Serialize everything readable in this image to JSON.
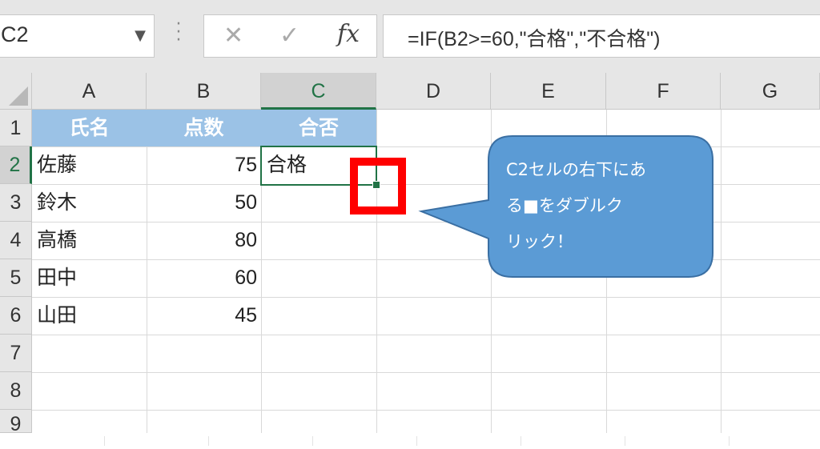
{
  "formula_bar": {
    "name_box": "C2",
    "cancel_icon": "✕",
    "enter_icon": "✓",
    "fx_label": "fx",
    "formula": "=IF(B2>=60,\"合格\",\"不合格\")"
  },
  "columns": [
    "A",
    "B",
    "C",
    "D",
    "E",
    "F",
    "G"
  ],
  "rows": [
    "1",
    "2",
    "3",
    "4",
    "5",
    "6",
    "7",
    "8",
    "9"
  ],
  "active_cell": "C2",
  "table": {
    "headers": [
      "氏名",
      "点数",
      "合否"
    ],
    "rows": [
      {
        "name": "佐藤",
        "score": "75",
        "result": "合格"
      },
      {
        "name": "鈴木",
        "score": "50",
        "result": ""
      },
      {
        "name": "高橋",
        "score": "80",
        "result": ""
      },
      {
        "name": "田中",
        "score": "60",
        "result": ""
      },
      {
        "name": "山田",
        "score": "45",
        "result": ""
      }
    ],
    "header_color": "#9bc2e6"
  },
  "callout": {
    "line1": "C2セルの右下にあ",
    "line2": "る■をダブルク",
    "line3": "リック！",
    "fill_color": "#5b9bd5"
  },
  "highlight_color": "#ff0000",
  "selection_color": "#217346"
}
